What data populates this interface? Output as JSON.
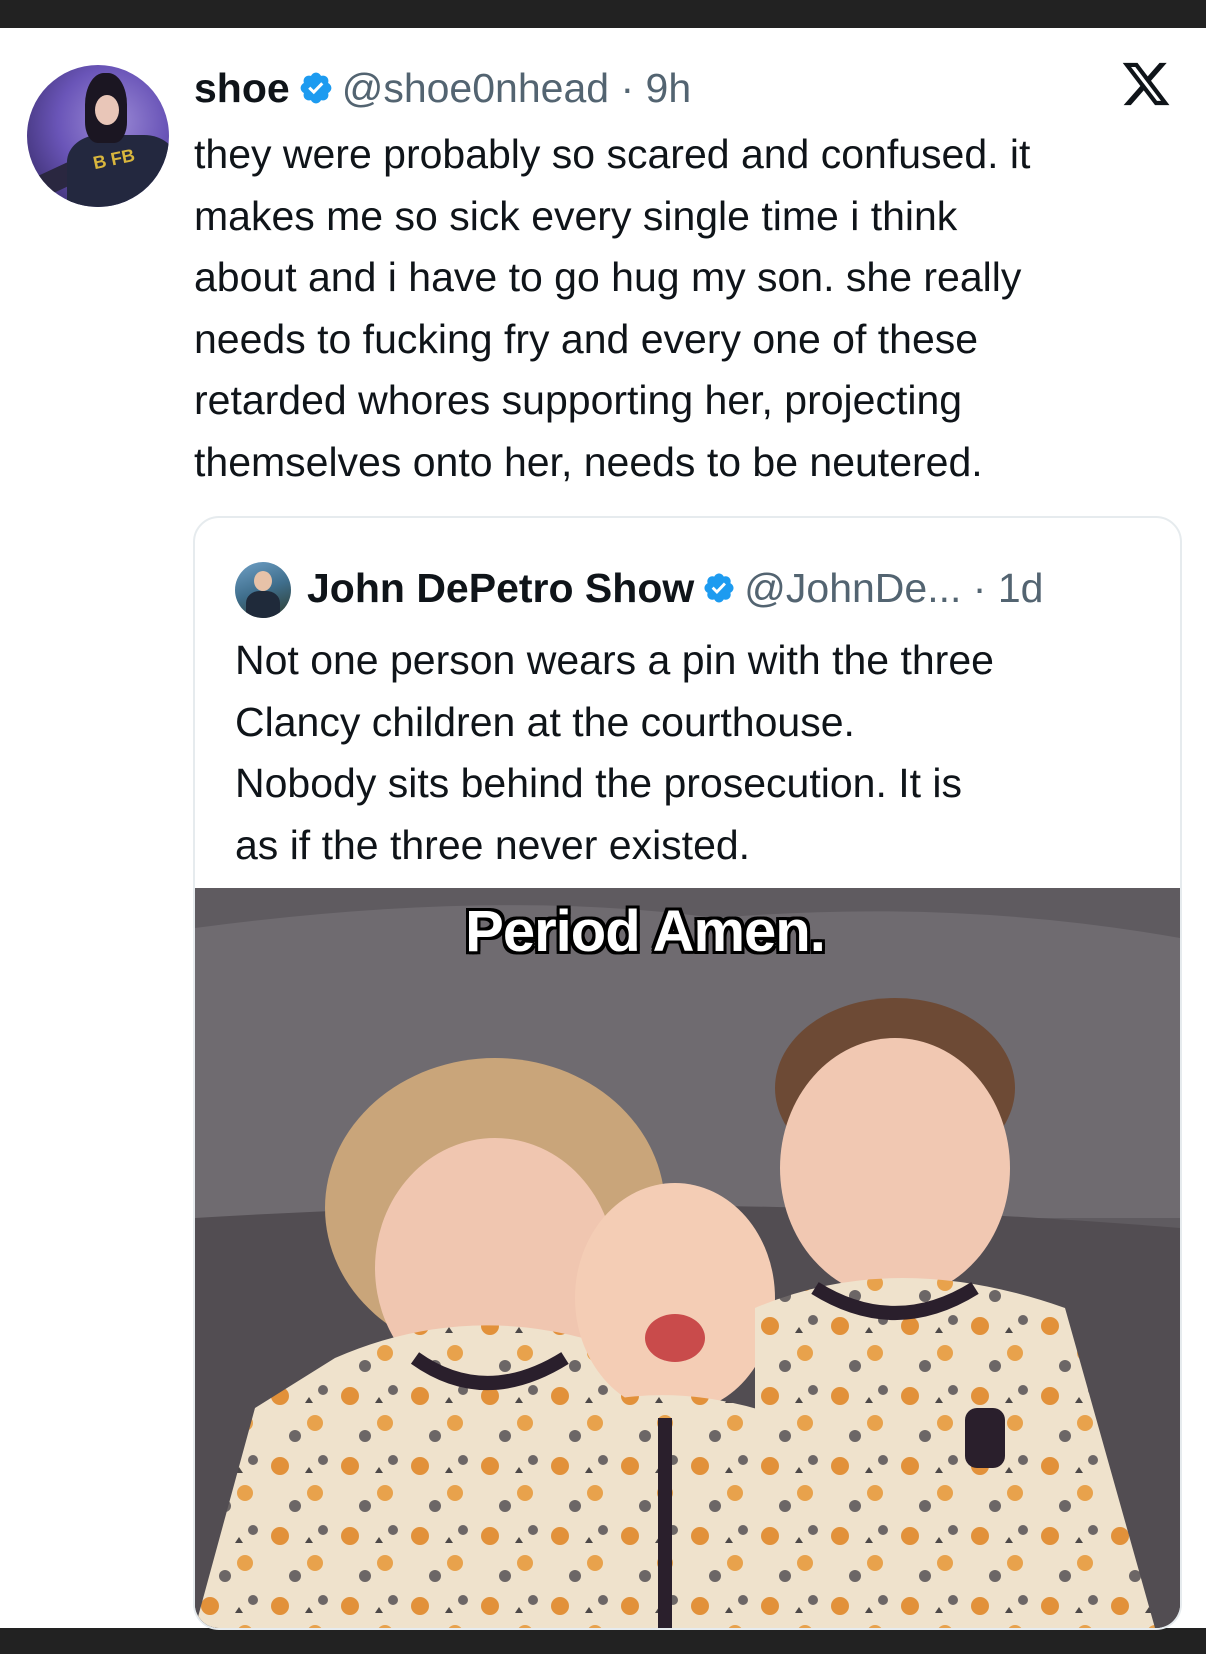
{
  "tweet": {
    "author_name": "shoe",
    "handle": "@shoe0nhead",
    "separator": "·",
    "time": "9h",
    "text": "they were probably so scared and confused. it\nmakes me so sick every single time i think\nabout and i have to go hug my son. she really\nneeds to fucking fry and every one of these\nretarded whores supporting her, projecting\nthemselves onto her, needs to be neutered.",
    "avatar_icon": "profile-photo",
    "platform_icon": "x-logo"
  },
  "quoted": {
    "author_name": "John DePetro Show",
    "handle": "@JohnDe...",
    "separator": "·",
    "time": "1d",
    "text": "Not one person wears a pin with the three\nClancy children at the courthouse.\nNobody sits behind the prosecution. It is\nas if the three never existed.",
    "image_caption": "Period Amen."
  },
  "colors": {
    "verified_badge": "#1d9bf0",
    "secondary_text": "#536471",
    "primary_text": "#0f1419",
    "frame": "#222222"
  }
}
